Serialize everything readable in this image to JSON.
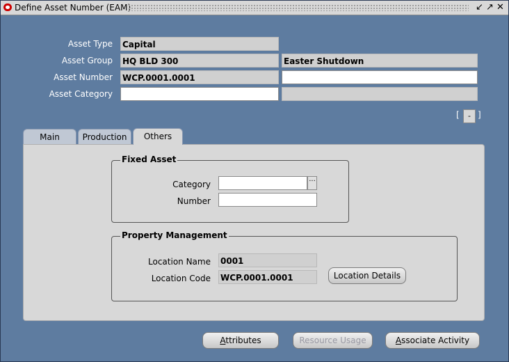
{
  "window": {
    "title": "Define Asset Number (EAM)"
  },
  "header": {
    "asset_type_label": "Asset Type",
    "asset_type": "Capital",
    "asset_group_label": "Asset Group",
    "asset_group": "HQ BLD 300",
    "asset_group_desc": "Easter Shutdown",
    "asset_number_label": "Asset Number",
    "asset_number": "WCP.0001.0001",
    "asset_number_desc": "",
    "asset_category_label": "Asset Category",
    "asset_category": "",
    "asset_category_desc": "",
    "folder_bracket_left": "[",
    "folder_button": "-",
    "folder_bracket_right": "]"
  },
  "tabs": [
    {
      "label": "Main",
      "active": false
    },
    {
      "label": "Production",
      "active": false
    },
    {
      "label": "Others",
      "active": true
    }
  ],
  "fixed_asset": {
    "title": "Fixed Asset",
    "category_label": "Category",
    "category": "",
    "lov_glyph": "···",
    "number_label": "Number",
    "number": ""
  },
  "property_management": {
    "title": "Property Management",
    "location_name_label": "Location Name",
    "location_name": "0001",
    "location_code_label": "Location Code",
    "location_code": "WCP.0001.0001",
    "location_details_button": "Location Details"
  },
  "buttons": {
    "attributes_mnemonic": "A",
    "attributes_rest": "ttributes",
    "resource_usage": "Resource Usage",
    "associate_mnemonic": "A",
    "associate_rest": "ssociate Activity"
  }
}
